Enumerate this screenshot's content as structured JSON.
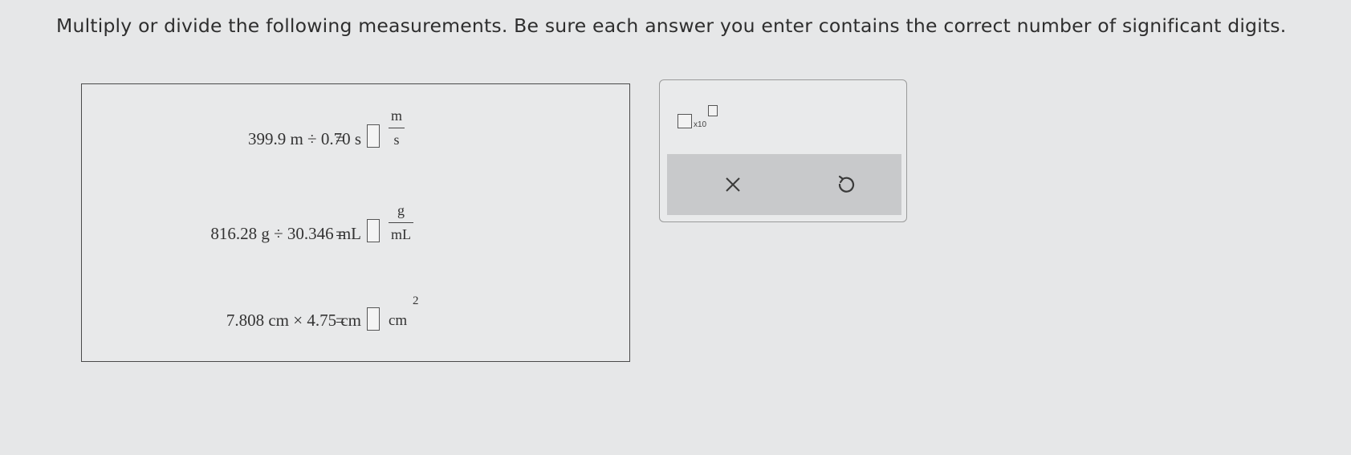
{
  "instructions": "Multiply or divide the following measurements. Be sure each answer you enter contains the correct number of significant digits.",
  "problems": [
    {
      "expression": "399.9 m ÷ 0.70 s",
      "equals": "=",
      "unit_numerator": "m",
      "unit_denominator": "s"
    },
    {
      "expression": "816.28 g ÷ 30.346 mL",
      "equals": "=",
      "unit_numerator": "g",
      "unit_denominator": "mL"
    },
    {
      "expression": "7.808 cm × 4.75 cm",
      "equals": "=",
      "unit": "cm",
      "unit_exponent": "2"
    }
  ],
  "toolbox": {
    "sci_notation_label": "x10",
    "clear_icon": "close-icon",
    "undo_icon": "undo-icon"
  }
}
